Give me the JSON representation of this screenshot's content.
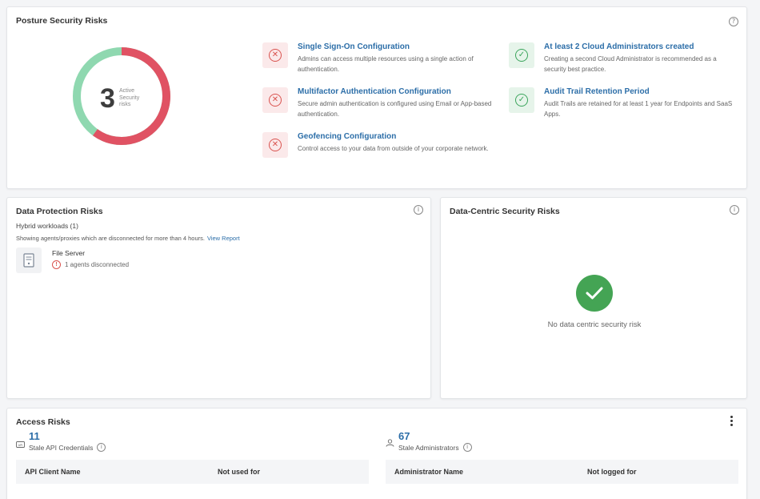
{
  "posture": {
    "title": "Posture Security Risks",
    "help_icon": "question-icon",
    "count": "3",
    "count_label": "Active Security risks",
    "donut": {
      "risk_fraction": 0.6,
      "risk_color": "#e05263",
      "ok_color": "#8fd8b0"
    },
    "risks": [
      {
        "status": "bad",
        "title": "Single Sign-On Configuration",
        "desc": "Admins can access multiple resources using a single action of authentication."
      },
      {
        "status": "bad",
        "title": "Multifactor Authentication Configuration",
        "desc": "Secure admin authentication is configured using Email or App-based authentication."
      },
      {
        "status": "bad",
        "title": "Geofencing Configuration",
        "desc": "Control access to your data from outside of your corporate network."
      },
      {
        "status": "good",
        "title": "At least 2 Cloud Administrators created",
        "desc": "Creating a second Cloud Administrator is recommended as a security best practice."
      },
      {
        "status": "good",
        "title": "Audit Trail Retention Period",
        "desc": "Audit Trails are retained for at least 1 year for Endpoints and SaaS Apps."
      }
    ]
  },
  "data_protection": {
    "title": "Data Protection Risks",
    "subtitle": "Hybrid workloads (1)",
    "note": "Showing agents/proxies which are disconnected for more than 4 hours.",
    "link": "View Report",
    "server_name": "File Server",
    "server_status": "1 agents disconnected"
  },
  "data_centric": {
    "title": "Data-Centric Security Risks",
    "message": "No data centric security risk"
  },
  "access": {
    "title": "Access Risks",
    "api": {
      "count": "11",
      "label": "Stale API Credentials"
    },
    "admins": {
      "count": "67",
      "label": "Stale Administrators"
    },
    "api_table": {
      "col1": "API Client Name",
      "col2": "Not used for"
    },
    "admin_table": {
      "col1": "Administrator Name",
      "col2": "Not logged for"
    }
  },
  "colors": {
    "link": "#2c6ea8",
    "error": "#d9534f",
    "success": "#44a454"
  }
}
